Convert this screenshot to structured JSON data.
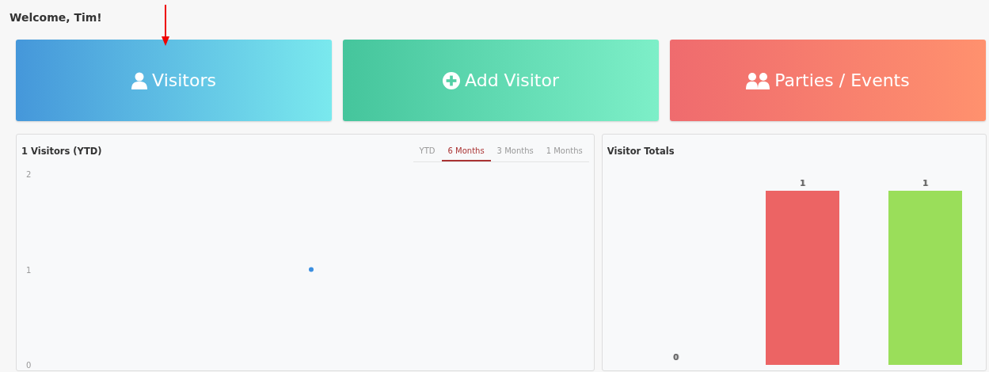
{
  "greeting": "Welcome, Tim!",
  "tiles": [
    {
      "kind": "visitors",
      "label": "Visitors"
    },
    {
      "kind": "add",
      "label": "Add Visitor"
    },
    {
      "kind": "parties",
      "label": "Parties / Events"
    }
  ],
  "visitors_panel": {
    "title": "1 Visitors (YTD)",
    "tabs": [
      {
        "label": "YTD",
        "selected": false
      },
      {
        "label": "6 Months",
        "selected": true
      },
      {
        "label": "3 Months",
        "selected": false
      },
      {
        "label": "1 Months",
        "selected": false
      }
    ],
    "y_axis_labels": [
      "2",
      "1",
      "0"
    ]
  },
  "totals_panel": {
    "title": "Visitor Totals",
    "bars": [
      {
        "value_label": "0"
      },
      {
        "value_label": "1",
        "color": "#ec6464"
      },
      {
        "value_label": "1",
        "color": "#9ade5a"
      }
    ]
  }
}
